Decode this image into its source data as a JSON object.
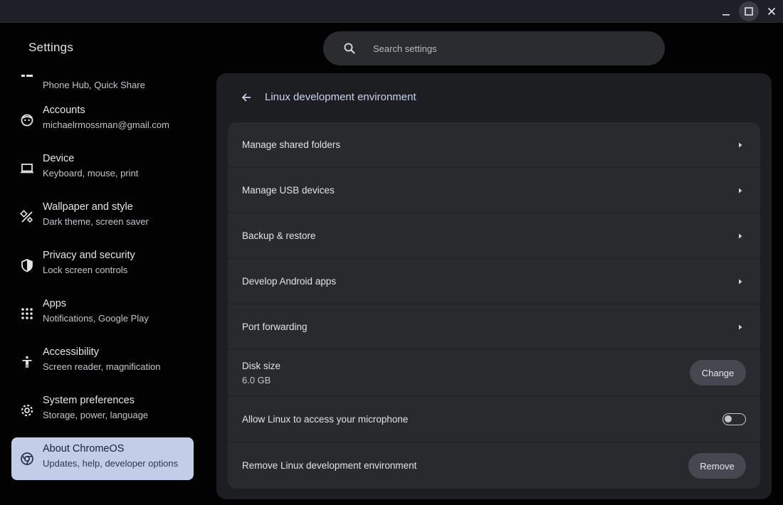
{
  "window": {
    "controls": [
      "minimize-icon",
      "maximize-icon",
      "close-icon"
    ]
  },
  "app": {
    "title": "Settings"
  },
  "search": {
    "placeholder": "Search settings",
    "value": ""
  },
  "sidebar": {
    "items": [
      {
        "label": "",
        "sub": "Phone Hub, Quick Share",
        "icon": "connected-devices-icon"
      },
      {
        "label": "Accounts",
        "sub": "michaelrmossman@gmail.com",
        "icon": "account-face-icon"
      },
      {
        "label": "Device",
        "sub": "Keyboard, mouse, print",
        "icon": "laptop-icon"
      },
      {
        "label": "Wallpaper and style",
        "sub": "Dark theme, screen saver",
        "icon": "paint-brush-icon"
      },
      {
        "label": "Privacy and security",
        "sub": "Lock screen controls",
        "icon": "shield-icon"
      },
      {
        "label": "Apps",
        "sub": "Notifications, Google Play",
        "icon": "apps-grid-icon"
      },
      {
        "label": "Accessibility",
        "sub": "Screen reader, magnification",
        "icon": "accessibility-icon"
      },
      {
        "label": "System preferences",
        "sub": "Storage, power, language",
        "icon": "gear-icon"
      },
      {
        "label": "About ChromeOS",
        "sub": "Updates, help, developer options",
        "icon": "chrome-icon",
        "active": true
      }
    ]
  },
  "page": {
    "title": "Linux development environment",
    "rows": [
      {
        "label": "Manage shared folders",
        "type": "link"
      },
      {
        "label": "Manage USB devices",
        "type": "link"
      },
      {
        "label": "Backup & restore",
        "type": "link"
      },
      {
        "label": "Develop Android apps",
        "type": "link"
      },
      {
        "label": "Port forwarding",
        "type": "link"
      }
    ],
    "disk": {
      "label": "Disk size",
      "value": "6.0 GB",
      "button": "Change"
    },
    "microphone": {
      "label": "Allow Linux to access your microphone",
      "enabled": false
    },
    "remove": {
      "label": "Remove Linux development environment",
      "button": "Remove"
    }
  },
  "colors": {
    "background": "#020203",
    "panel": "#1d1e21",
    "list": "#292a2d",
    "active_nav": "#c2cde8",
    "accent_text": "#c9d2ee"
  }
}
